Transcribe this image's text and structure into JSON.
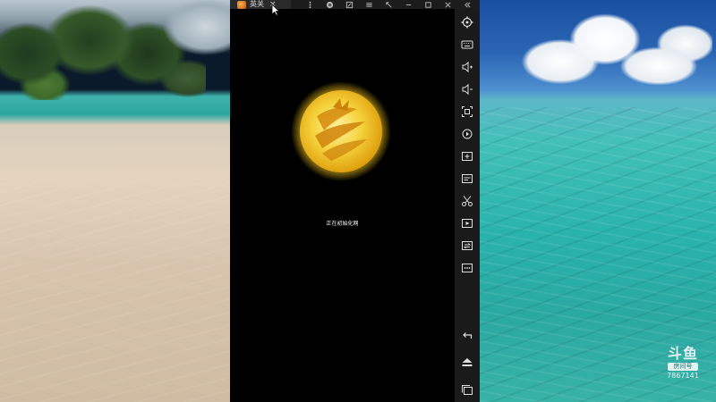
{
  "window": {
    "tab_title": "英关",
    "tab_close": "×",
    "tab_icon": "game-fire-icon",
    "title_controls": [
      "more-vertical-icon",
      "skin-icon",
      "edit-icon",
      "menu-icon",
      "expand-icon",
      "minimize-icon",
      "restore-icon",
      "close-icon",
      "collapse-sidebar-icon"
    ]
  },
  "app_screen": {
    "loading_text": "正在初始化网",
    "logo": "golden-sun-logo-icon"
  },
  "sidebar": {
    "items": [
      {
        "name": "settings-icon"
      },
      {
        "name": "keyboard-icon"
      },
      {
        "name": "volume-up-icon"
      },
      {
        "name": "volume-down-icon"
      },
      {
        "name": "screenshot-icon"
      },
      {
        "name": "rotate-icon"
      },
      {
        "name": "install-apk-icon"
      },
      {
        "name": "resolution-icon"
      },
      {
        "name": "cut-icon"
      },
      {
        "name": "video-record-icon"
      },
      {
        "name": "sync-icon"
      },
      {
        "name": "more-icon"
      }
    ],
    "nav": [
      {
        "name": "back-icon"
      },
      {
        "name": "home-icon"
      },
      {
        "name": "recent-apps-icon"
      }
    ]
  },
  "watermark": {
    "logo": "斗鱼",
    "badge": "房间号",
    "room_id": "7867141"
  },
  "colors": {
    "emulator_bg": "#000000",
    "sidebar_bg": "#1a1a1a",
    "titlebar_bg": "#1c1c1c",
    "sun_gold": "#f2c21a"
  }
}
